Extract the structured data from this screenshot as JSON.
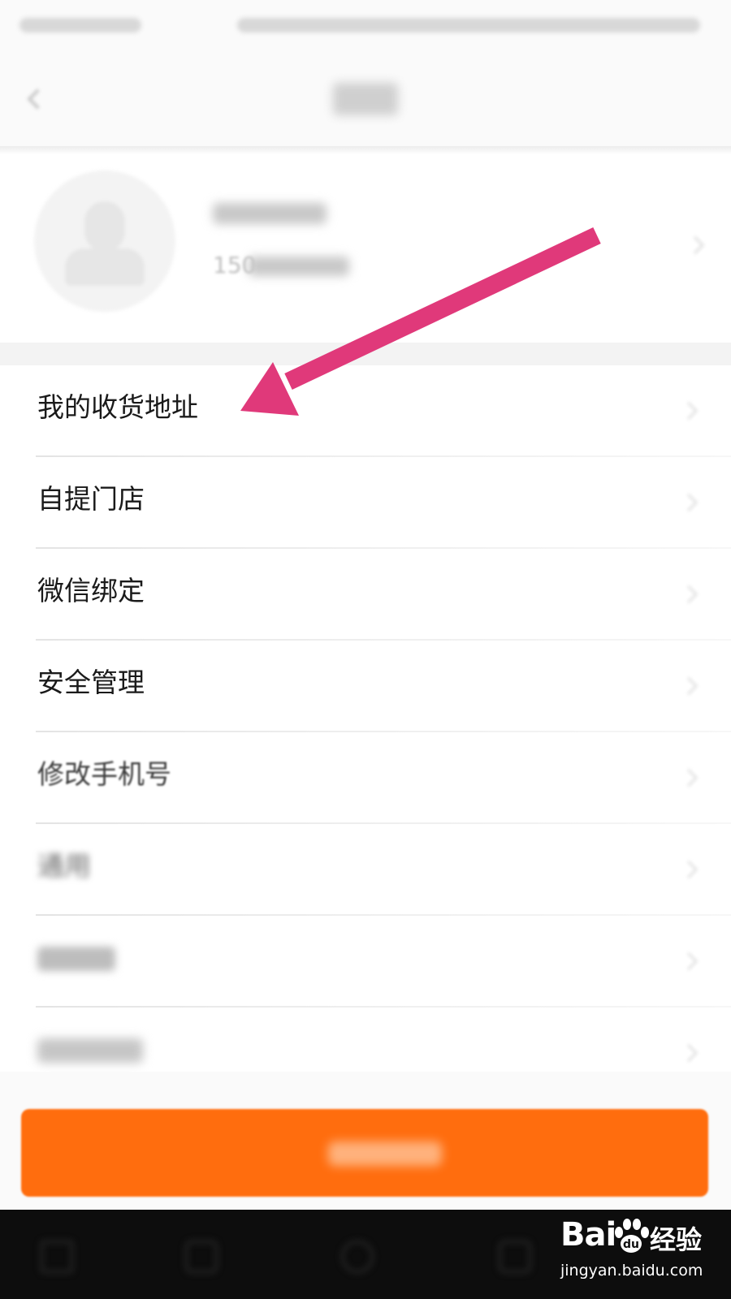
{
  "menu": {
    "items": [
      {
        "label": "我的收货地址"
      },
      {
        "label": "自提门店"
      },
      {
        "label": "微信绑定"
      },
      {
        "label": "安全管理"
      },
      {
        "label": "修改手机号"
      },
      {
        "label": "通用"
      },
      {
        "label": ""
      },
      {
        "label": ""
      }
    ]
  },
  "profile": {
    "phone_prefix": "150"
  },
  "watermark": {
    "logo": "Bai",
    "logo_suffix": "经验",
    "url": "jingyan.baidu.com"
  },
  "colors": {
    "accent": "#ff6d0e",
    "annotation_arrow": "#e0397a"
  }
}
